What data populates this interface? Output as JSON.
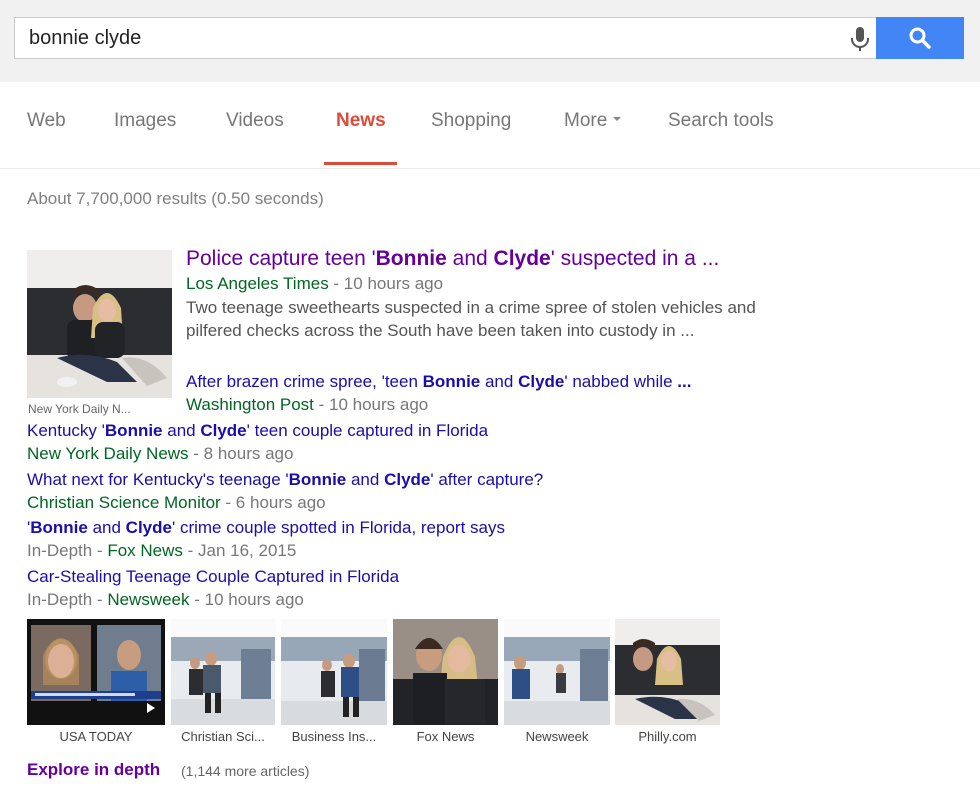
{
  "search": {
    "query": "bonnie clyde",
    "mic_icon": "microphone-icon",
    "button_icon": "magnifier-icon",
    "accent": "#4285f4"
  },
  "tabs": [
    {
      "label": "Web"
    },
    {
      "label": "Images"
    },
    {
      "label": "Videos"
    },
    {
      "label": "News",
      "active": true
    },
    {
      "label": "Shopping"
    },
    {
      "label": "More"
    },
    {
      "label": "Search tools"
    }
  ],
  "stats": "About 7,700,000 results (0.50 seconds)",
  "top_story": {
    "title_pre": "Police capture teen '",
    "title_b1": "Bonnie",
    "title_mid": " and ",
    "title_b2": "Clyde",
    "title_post": "' suspected in a ...",
    "source": "Los Angeles Times",
    "time": " - 10 hours ago",
    "snippet": "Two teenage sweethearts suspected in a crime spree of stolen vehicles and pilfered checks across the South have been taken into custody in ...",
    "thumb_caption": "New York Daily N..."
  },
  "related": [
    {
      "pre": "After brazen crime spree, 'teen ",
      "b1": "Bonnie",
      "mid": " and ",
      "b2": "Clyde",
      "post": "' nabbed while ",
      "ell": "...",
      "source": "Washington Post",
      "time": " - 10 hours ago"
    },
    {
      "pre": "Kentucky '",
      "b1": "Bonnie",
      "mid": " and ",
      "b2": "Clyde",
      "post": "' teen couple captured in Florida",
      "source": "New York Daily News",
      "time": " - 8 hours ago"
    },
    {
      "pre": "What next for Kentucky's teenage '",
      "b1": "Bonnie",
      "mid": " and ",
      "b2": "Clyde",
      "post": "' after capture?",
      "source": "Christian Science Monitor",
      "time": " - 6 hours ago"
    },
    {
      "pre": "'",
      "b1": "Bonnie",
      "mid": " and ",
      "b2": "Clyde",
      "post": "' crime couple spotted in Florida, report says",
      "indepth": "In-Depth - ",
      "source": "Fox News",
      "time": " - Jan 16, 2015"
    },
    {
      "text": "Car-Stealing Teenage Couple Captured in Florida",
      "indepth": "In-Depth - ",
      "source": "Newsweek",
      "time": " - 10 hours ago"
    }
  ],
  "image_strip": [
    {
      "caption": "USA TODAY"
    },
    {
      "caption": "Christian Sci..."
    },
    {
      "caption": "Business Ins..."
    },
    {
      "caption": "Fox News"
    },
    {
      "caption": "Newsweek"
    },
    {
      "caption": "Philly.com"
    }
  ],
  "explore": {
    "label": "Explore in depth",
    "count": "(1,144 more articles)"
  },
  "colors": {
    "title": "#660099",
    "link": "#1a0dab",
    "source": "#006621",
    "active_tab": "#dd4b39"
  }
}
